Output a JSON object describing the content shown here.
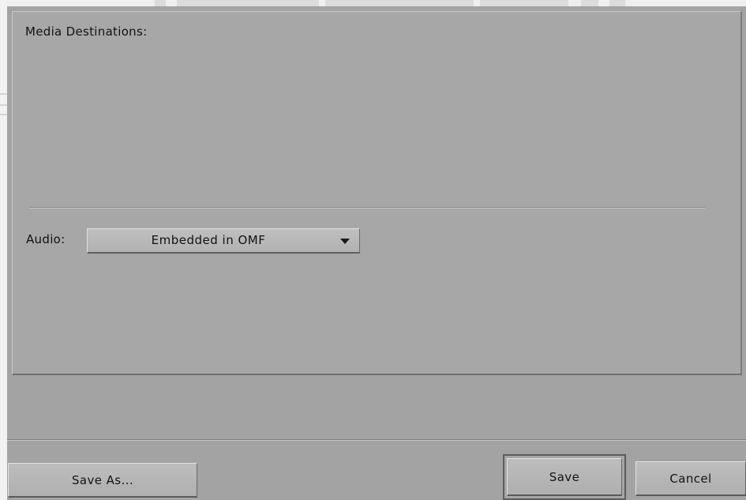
{
  "dialog": {
    "media_destinations_label": "Media Destinations:",
    "audio_label": "Audio:",
    "audio_select": {
      "value": "Embedded in OMF",
      "arrow_icon": "chevron-down-icon"
    }
  },
  "footer": {
    "save_as_label": "Save As...",
    "save_label": "Save",
    "cancel_label": "Cancel"
  },
  "colors": {
    "panel_background": "#a7a7a7",
    "button_face": "#b5b5b5",
    "text": "#111111"
  }
}
